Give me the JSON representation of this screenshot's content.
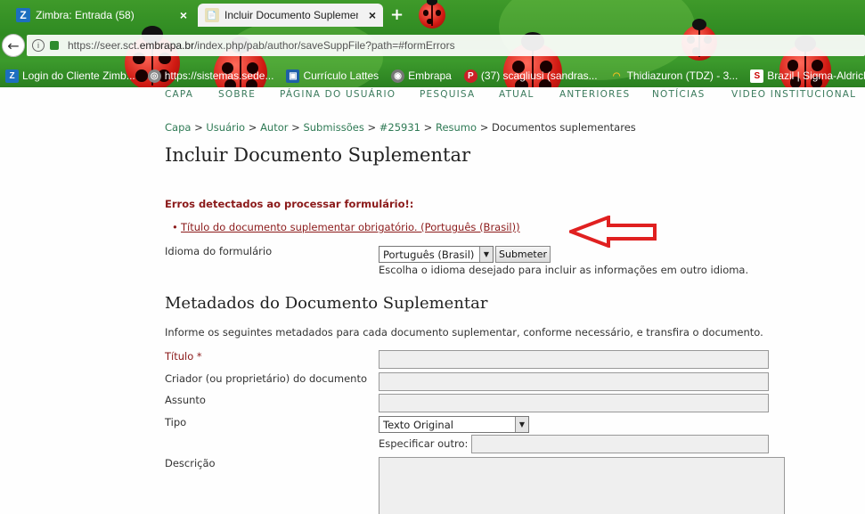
{
  "browser": {
    "tabs": [
      {
        "icon": "Z",
        "label": "Zimbra: Entrada (58)",
        "close": "×"
      },
      {
        "icon": "📄",
        "label": "Incluir Documento Suplemen",
        "close": "×"
      }
    ],
    "new_tab": "+",
    "url_prefix": "https://seer.sct.",
    "url_domain": "embrapa.br",
    "url_suffix": "/index.php/pab/author/saveSuppFile?path=#formErrors",
    "bookmarks": [
      {
        "icon": "Z",
        "label": "Login do Cliente Zimb..."
      },
      {
        "icon": "◎",
        "label": "https://sistemas.sede..."
      },
      {
        "icon": "▣",
        "label": "Currículo Lattes"
      },
      {
        "icon": "◉",
        "label": "Embrapa"
      },
      {
        "icon": "P",
        "label": "(37) scagliusi (sandras..."
      },
      {
        "icon": "◠",
        "label": "Thidiazuron (TDZ) - 3..."
      },
      {
        "icon": "S",
        "label": "Brazil | Sigma-Aldrich"
      }
    ]
  },
  "nav": [
    "CAPA",
    "SOBRE",
    "PÁGINA DO USUÁRIO",
    "PESQUISA",
    "ATUAL",
    "ANTERIORES",
    "NOTÍCIAS",
    "VIDEO INSTITUCIONAL"
  ],
  "breadcrumb": {
    "items": [
      "Capa",
      "Usuário",
      "Autor",
      "Submissões",
      "#25931",
      "Resumo"
    ],
    "current": "Documentos suplementares",
    "sep": ">"
  },
  "page_title": "Incluir Documento Suplementar",
  "errors": {
    "heading": "Erros detectados ao processar formulário!:",
    "items": [
      "Título do documento suplementar obrigatório. (Português (Brasil))"
    ]
  },
  "form_language": {
    "label": "Idioma do formulário",
    "selected": "Português (Brasil)",
    "submit": "Submeter",
    "hint": "Escolha o idioma desejado para incluir as informações em outro idioma."
  },
  "metadata": {
    "heading": "Metadados do Documento Suplementar",
    "intro": "Informe os seguintes metadados para cada documento suplementar, conforme necessário, e transfira o documento.",
    "title_label": "Título *",
    "creator_label": "Criador (ou proprietário) do documento",
    "subject_label": "Assunto",
    "type_label": "Tipo",
    "type_selected": "Texto Original",
    "other_label": "Especificar outro:",
    "description_label": "Descrição"
  },
  "colors": {
    "link": "#2f7a55",
    "error": "#8b1a1a",
    "annotation_arrow": "#e02020"
  }
}
